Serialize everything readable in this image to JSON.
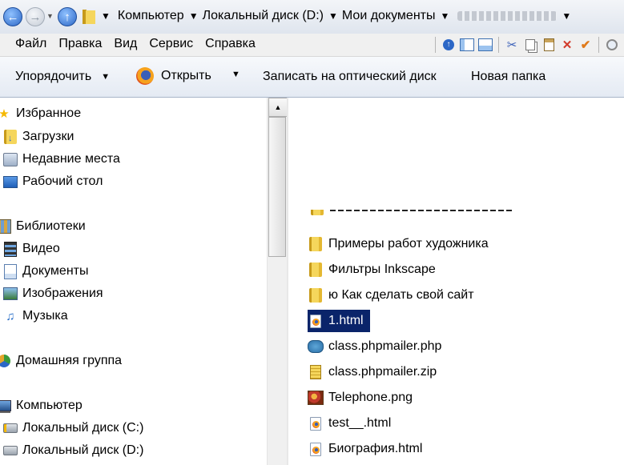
{
  "address_bar": {
    "crumbs": [
      "Компьютер",
      "Локальный диск (D:)",
      "Мои документы"
    ]
  },
  "menu": {
    "items": [
      "Файл",
      "Правка",
      "Вид",
      "Сервис",
      "Справка"
    ]
  },
  "toolbar_icons": [
    "up-arrow-icon",
    "view-details-icon",
    "view-preview-icon",
    "cut-icon",
    "copy-icon",
    "paste-icon",
    "delete-icon",
    "properties-check-icon",
    "search-magnifier-icon"
  ],
  "command_bar": {
    "organize": "Упорядочить",
    "open": "Открыть",
    "burn": "Записать на оптический диск",
    "new_folder": "Новая папка"
  },
  "nav_pane": {
    "favorites": "Избранное",
    "downloads": "Загрузки",
    "recent": "Недавние места",
    "desktop": "Рабочий стол",
    "libraries": "Библиотеки",
    "video": "Видео",
    "documents": "Документы",
    "images": "Изображения",
    "music": "Музыка",
    "homegroup": "Домашняя группа",
    "computer": "Компьютер",
    "disk_c": "Локальный диск (C:)",
    "disk_d": "Локальный диск (D:)"
  },
  "files": [
    {
      "name": "Примеры работ художника",
      "type": "folder"
    },
    {
      "name": "Фильтры Inkscape",
      "type": "folder"
    },
    {
      "name": "ю Как сделать свой сайт",
      "type": "folder"
    },
    {
      "name": "1.html",
      "type": "html",
      "selected": true
    },
    {
      "name": "class.phpmailer.php",
      "type": "php"
    },
    {
      "name": "class.phpmailer.zip",
      "type": "zip"
    },
    {
      "name": "Telephone.png",
      "type": "png"
    },
    {
      "name": "test__.html",
      "type": "html"
    },
    {
      "name": "Биография.html",
      "type": "html"
    }
  ]
}
